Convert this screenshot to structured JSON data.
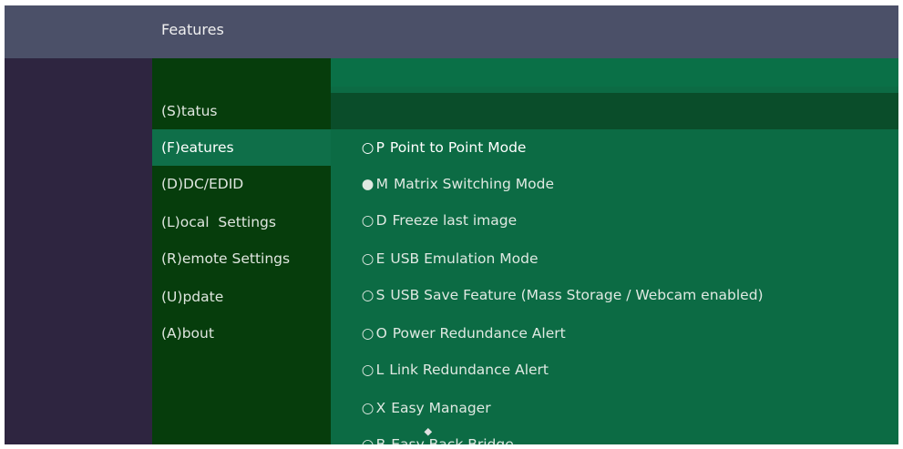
{
  "window": {
    "title": "Features"
  },
  "menu": {
    "items": [
      {
        "label": "(S)tatus",
        "active": false
      },
      {
        "label": "(F)eatures",
        "active": true
      },
      {
        "label": "(D)DC/EDID",
        "active": false
      },
      {
        "label": "(L)ocal  Settings",
        "active": false
      },
      {
        "label": "(R)emote Settings",
        "active": false
      },
      {
        "label": "(U)pdate",
        "active": false
      },
      {
        "label": "(A)bout",
        "active": false
      }
    ]
  },
  "features": {
    "options": [
      {
        "bullet": "○",
        "key": "P",
        "label": "Point to Point Mode",
        "selected": false,
        "highlighted": true
      },
      {
        "bullet": "●",
        "key": "M",
        "label": "Matrix Switching Mode",
        "selected": true,
        "highlighted": false
      },
      {
        "bullet": "○",
        "key": "D",
        "label": "Freeze last image",
        "selected": false,
        "highlighted": false
      },
      {
        "bullet": "○",
        "key": "E",
        "label": "USB Emulation Mode",
        "selected": false,
        "highlighted": false
      },
      {
        "bullet": "○",
        "key": "S",
        "label": "USB Save Feature (Mass Storage / Webcam enabled)",
        "selected": false,
        "highlighted": false
      },
      {
        "bullet": "○",
        "key": "O",
        "label": "Power Redundance Alert",
        "selected": false,
        "highlighted": false
      },
      {
        "bullet": "○",
        "key": "L",
        "label": "Link Redundance Alert",
        "selected": false,
        "highlighted": false
      },
      {
        "bullet": "○",
        "key": "X",
        "label": "Easy Manager",
        "selected": false,
        "highlighted": false
      },
      {
        "bullet": "○",
        "key": "B",
        "label": "Easy Back Bridge",
        "selected": false,
        "highlighted": false
      }
    ],
    "scroll_indicator": "⯁"
  },
  "colors": {
    "background": "#2e2540",
    "titlebar": "#4b5068",
    "menu_bg": "#063d0c",
    "menu_active": "#0f6f49",
    "content_bg": "#0c6b44",
    "content_highlight": "#0a4d2a"
  }
}
